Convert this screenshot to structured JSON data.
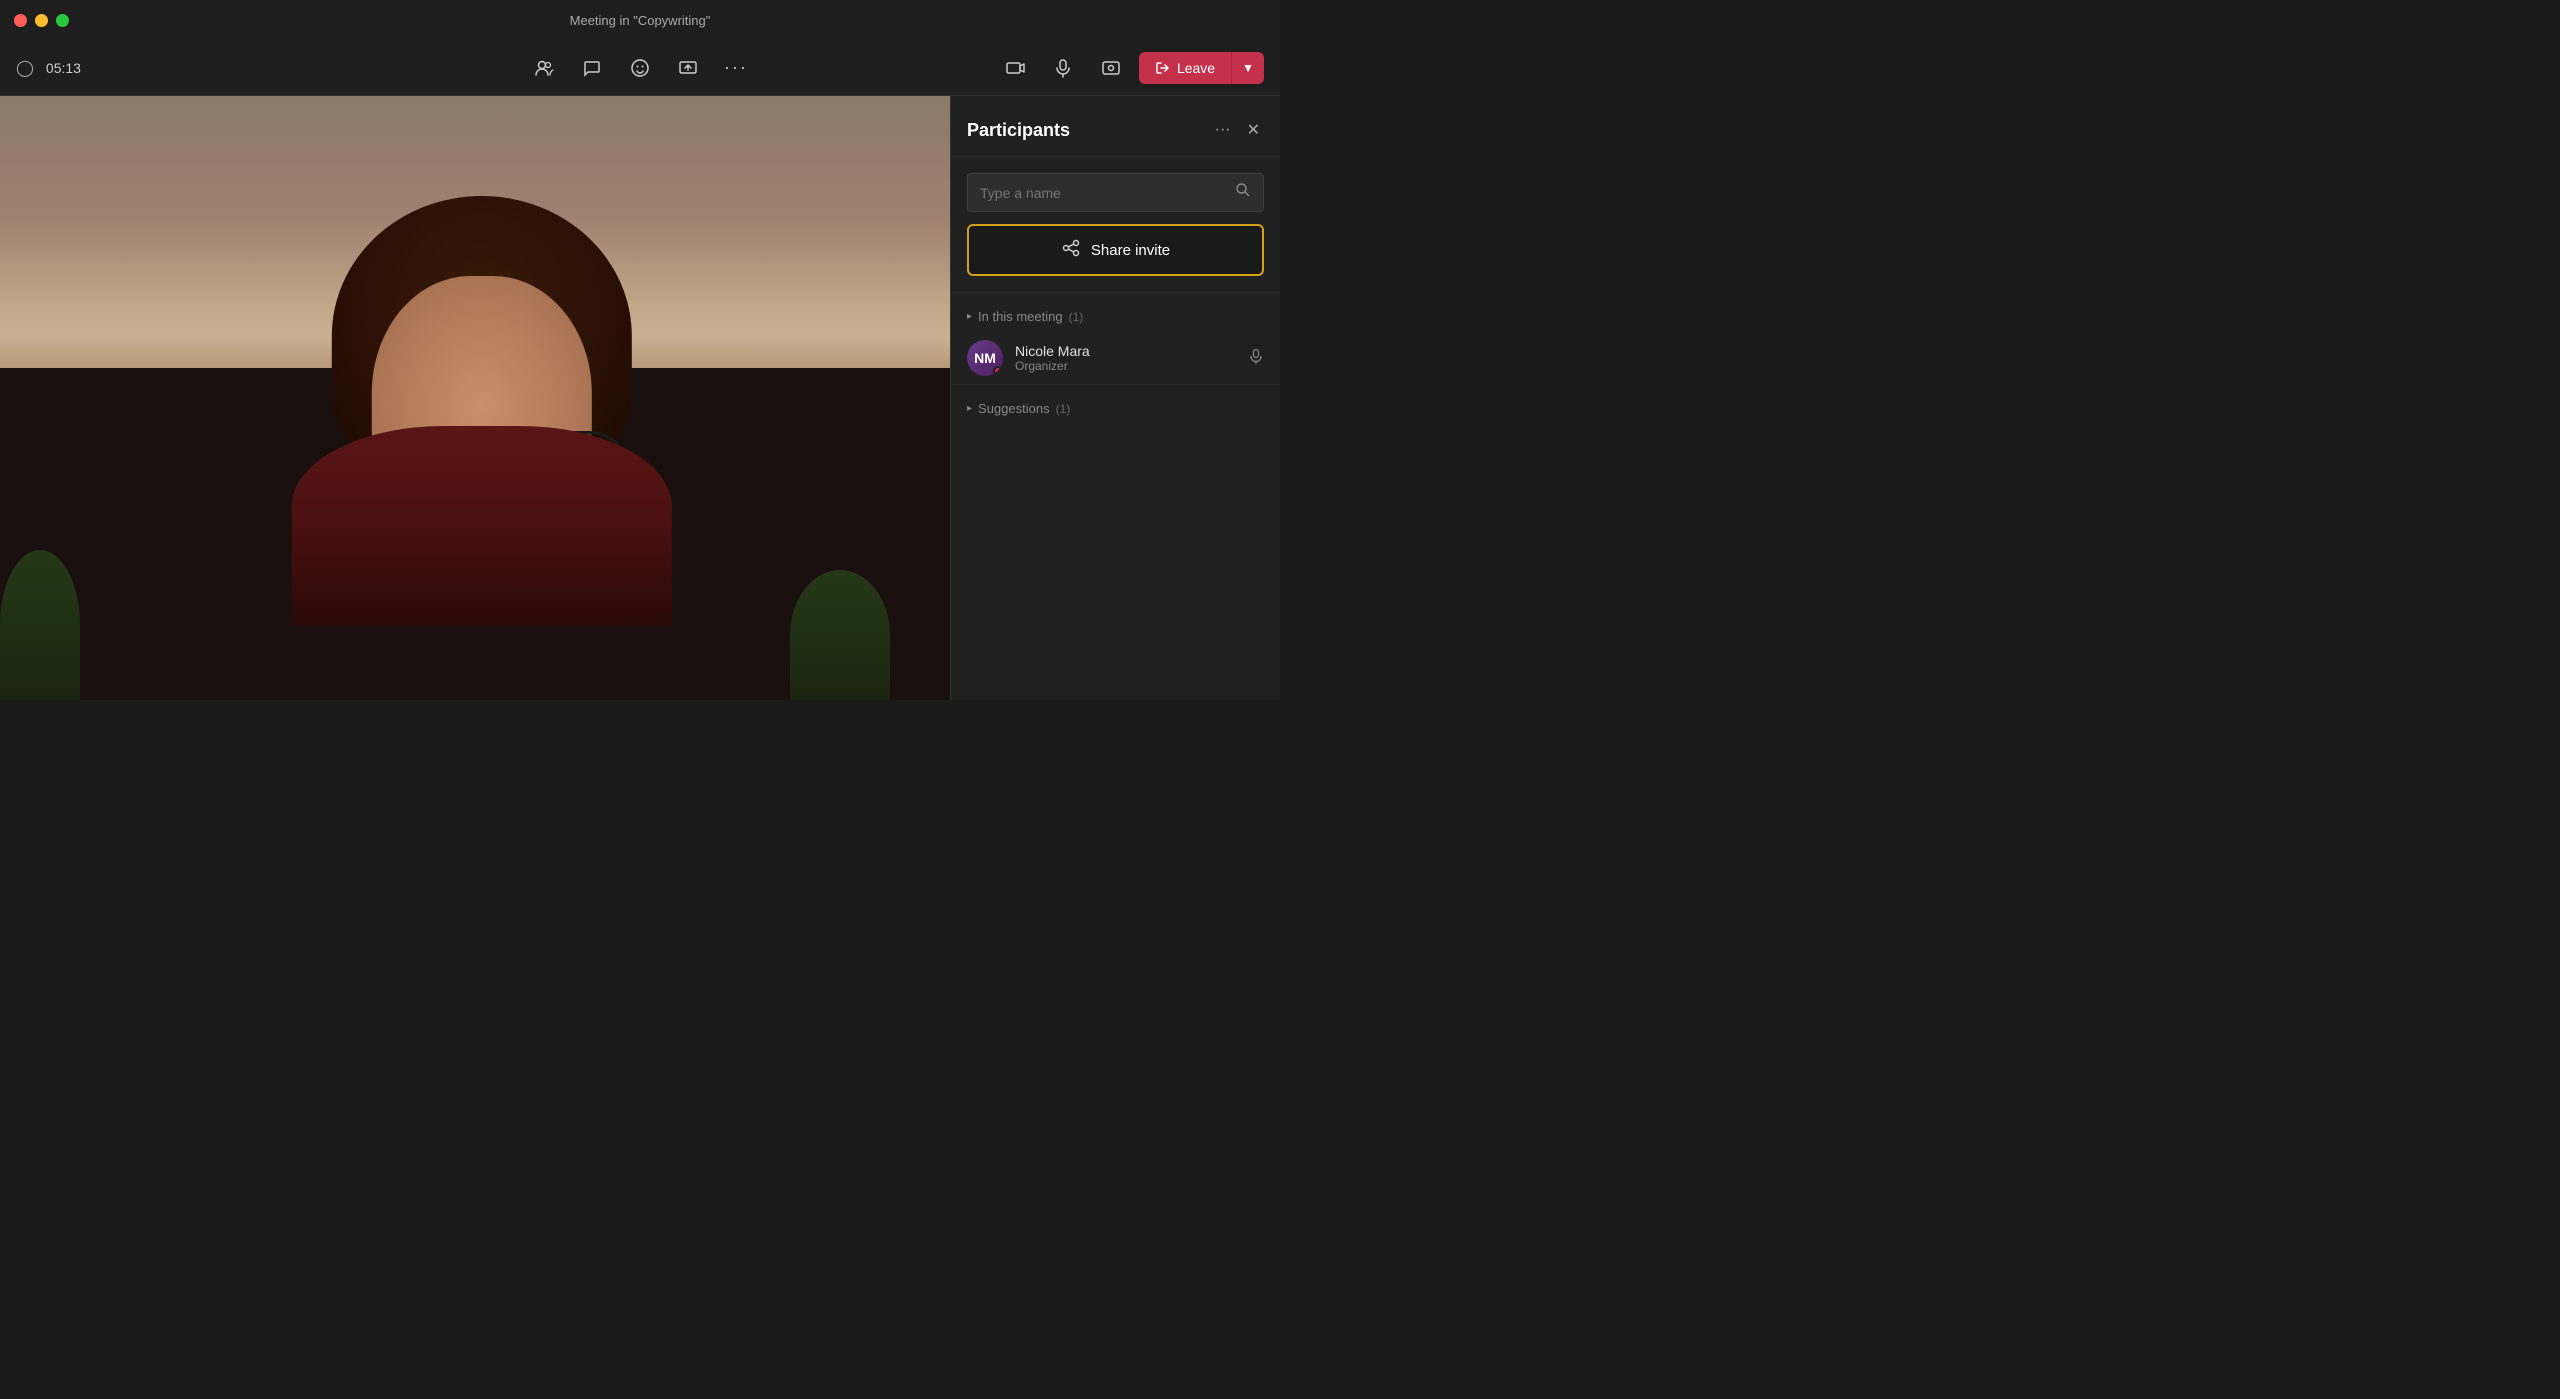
{
  "titleBar": {
    "title": "Meeting in \"Copywriting\""
  },
  "toolbar": {
    "time": "05:13",
    "buttons": [
      {
        "name": "people-icon",
        "icon": "👥",
        "label": ""
      },
      {
        "name": "chat-icon",
        "icon": "💬",
        "label": ""
      },
      {
        "name": "reactions-icon",
        "icon": "✋",
        "label": ""
      },
      {
        "name": "share-screen-icon",
        "icon": "⬆",
        "label": ""
      },
      {
        "name": "more-icon",
        "icon": "•••",
        "label": ""
      }
    ],
    "rightButtons": [
      {
        "name": "camera-icon",
        "icon": "📷"
      },
      {
        "name": "mic-icon",
        "icon": "🎤"
      },
      {
        "name": "settings-icon",
        "icon": "📺"
      }
    ],
    "leaveLabel": "Leave",
    "leaveChevron": "▼"
  },
  "participants": {
    "title": "Participants",
    "searchPlaceholder": "Type a name",
    "shareInviteLabel": "Share invite",
    "inMeeting": {
      "label": "In this meeting",
      "count": "(1)",
      "chevron": "▸"
    },
    "suggestions": {
      "label": "Suggestions",
      "count": "(1)",
      "chevron": "▸"
    },
    "members": [
      {
        "name": "Nicole Mara",
        "role": "Organizer",
        "initials": "NM",
        "avatarBg": "#6a3a8a"
      }
    ]
  },
  "icons": {
    "search": "🔍",
    "shareInvite": "↗",
    "mic": "🎤",
    "more": "···",
    "close": "✕"
  },
  "colors": {
    "leaveBtn": "#c4314b",
    "shareInviteBorder": "#d4a017",
    "panelBg": "#202020",
    "toolbarBg": "#1e1e1e"
  }
}
